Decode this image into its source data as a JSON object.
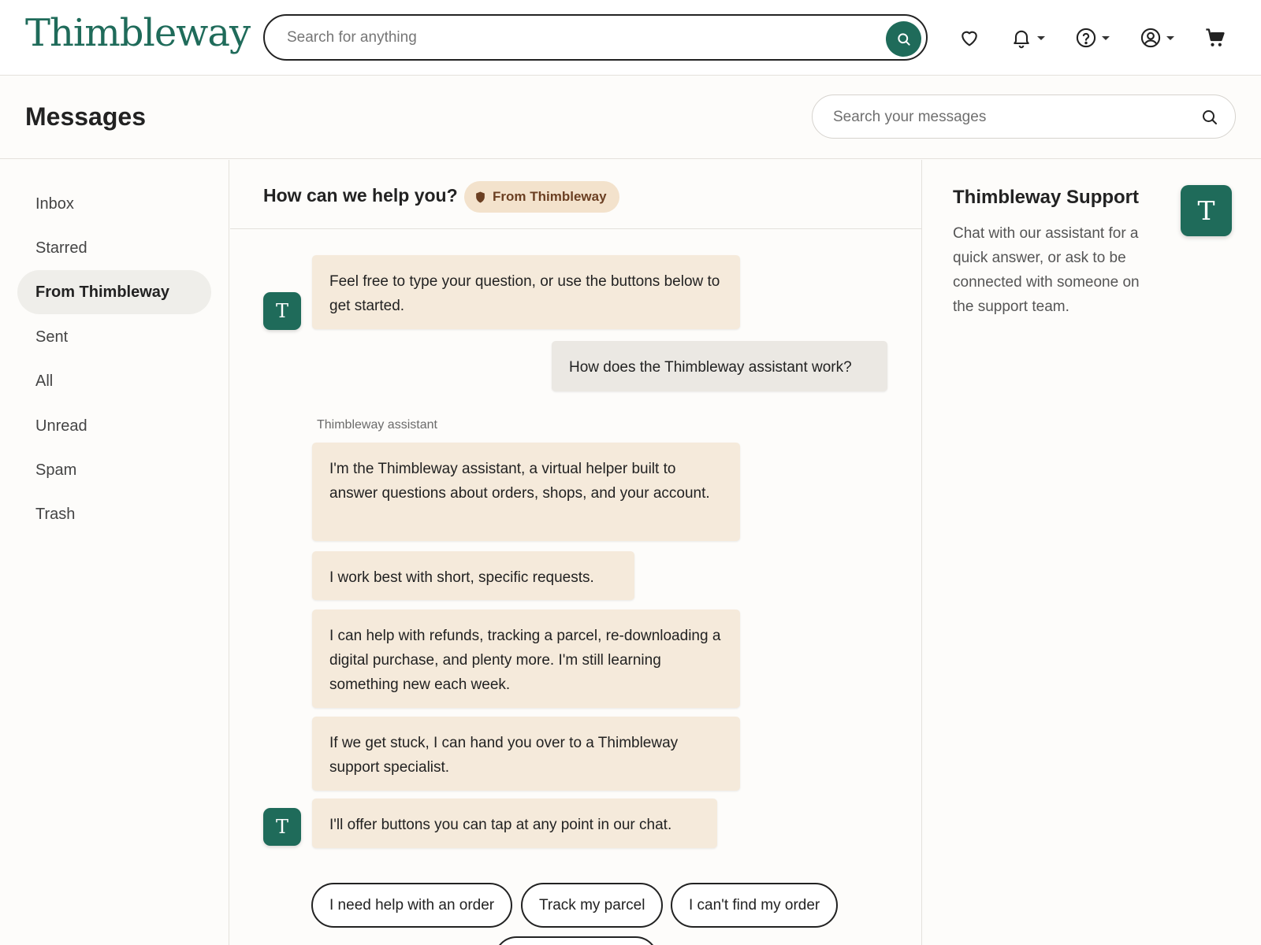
{
  "header": {
    "logo": "Thimbleway",
    "search_placeholder": "Search for anything",
    "icons": [
      "heart-icon",
      "bell-icon",
      "help-icon",
      "account-icon",
      "cart-icon"
    ],
    "brand_color": "#1f6b5a"
  },
  "page": {
    "title": "Messages",
    "search_placeholder": "Search your messages"
  },
  "sidebar": {
    "items": [
      {
        "label": "Inbox",
        "active": false
      },
      {
        "label": "Starred",
        "active": false
      },
      {
        "label": "From Thimbleway",
        "active": true
      },
      {
        "label": "Sent",
        "active": false
      },
      {
        "label": "All",
        "active": false
      },
      {
        "label": "Unread",
        "active": false
      },
      {
        "label": "Spam",
        "active": false
      },
      {
        "label": "Trash",
        "active": false
      }
    ]
  },
  "conversation": {
    "title": "How can we help you?",
    "badge": "From Thimbleway",
    "sender_label": "Thimbleway assistant",
    "avatar_letter": "T",
    "messages": [
      {
        "from": "assistant",
        "text": "Feel free to type your question, or use the buttons below to get started."
      },
      {
        "from": "user",
        "text": "How does the Thimbleway assistant work?"
      },
      {
        "from": "assistant",
        "text": "I'm the Thimbleway assistant, a virtual helper built to answer questions about orders, shops, and your account."
      },
      {
        "from": "assistant",
        "text": "I work best with short, specific requests."
      },
      {
        "from": "assistant",
        "text": "I can help with refunds, tracking a parcel, re-downloading a digital purchase, and plenty more. I'm still learning something new each week."
      },
      {
        "from": "assistant",
        "text": "If we get stuck, I can hand you over to a Thimbleway support specialist."
      },
      {
        "from": "assistant",
        "text": "I'll offer buttons you can tap at any point in our chat."
      }
    ],
    "quick_replies": [
      "I need help with an order",
      "Track my parcel",
      "I can't find my order"
    ]
  },
  "support_panel": {
    "name": "Thimbleway Support",
    "description": "Chat with our assistant for a quick answer, or ask to be connected with someone on the support team.",
    "avatar_letter": "T"
  }
}
